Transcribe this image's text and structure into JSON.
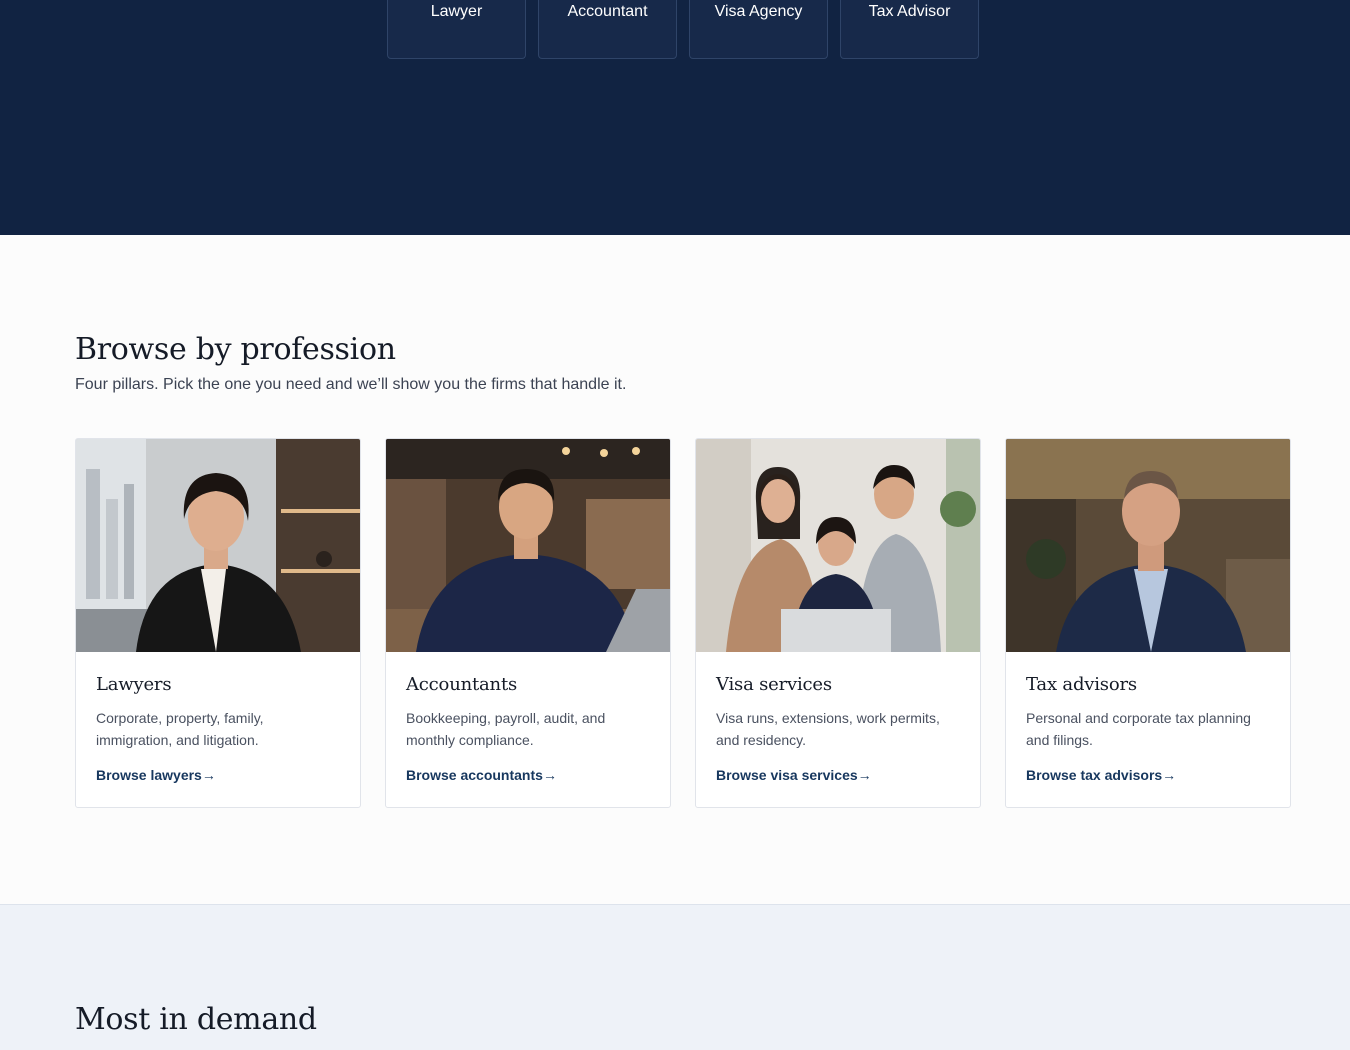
{
  "hero": {
    "tabs": [
      {
        "label": "Lawyer"
      },
      {
        "label": "Accountant"
      },
      {
        "label": "Visa Agency"
      },
      {
        "label": "Tax Advisor"
      }
    ]
  },
  "browse": {
    "title": "Browse by profession",
    "subtitle": "Four pillars. Pick the one you need and we’ll show you the firms that handle it.",
    "cards": [
      {
        "title": "Lawyers",
        "description": "Corporate, property, family, immigration, and litigation.",
        "link": "Browse lawyers",
        "arrow": "→"
      },
      {
        "title": "Accountants",
        "description": "Bookkeeping, payroll, audit, and monthly compliance.",
        "link": "Browse accountants",
        "arrow": "→"
      },
      {
        "title": "Visa services",
        "description": "Visa runs, extensions, work permits, and residency.",
        "link": "Browse visa services",
        "arrow": "→"
      },
      {
        "title": "Tax advisors",
        "description": "Personal and corporate tax planning and filings.",
        "link": "Browse tax advisors",
        "arrow": "→"
      }
    ]
  },
  "demand": {
    "title": "Most in demand"
  },
  "colors": {
    "hero_bg": "#112342",
    "accent_link": "#17375e",
    "demand_bg": "#eef2f8"
  }
}
